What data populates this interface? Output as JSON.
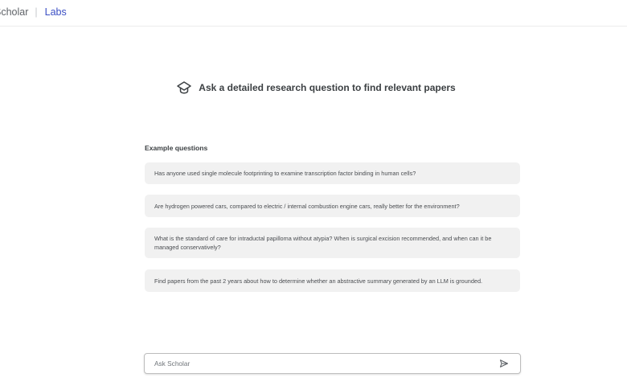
{
  "header": {
    "brand_name": "Scholar",
    "separator": "|",
    "labs_label": "Labs"
  },
  "hero": {
    "icon": "graduation-cap-icon",
    "text": "Ask a detailed research question to find relevant papers"
  },
  "examples": {
    "title": "Example questions",
    "items": [
      "Has anyone used single molecule footprinting to examine transcription factor binding in human cells?",
      "Are hydrogen powered cars, compared to electric / internal combustion engine cars, really better for the environment?",
      "What is the standard of care for intraductal papilloma without atypia? When is surgical excision recommended, and when can it be managed conservatively?",
      "Find papers from the past 2 years about how to determine whether an abstractive summary generated by an LLM is grounded."
    ]
  },
  "ask": {
    "placeholder": "Ask Scholar",
    "send_icon": "send-icon"
  },
  "colors": {
    "accent": "#3b4fc4",
    "card_bg": "#f1f1f1",
    "text": "#3c4043"
  }
}
